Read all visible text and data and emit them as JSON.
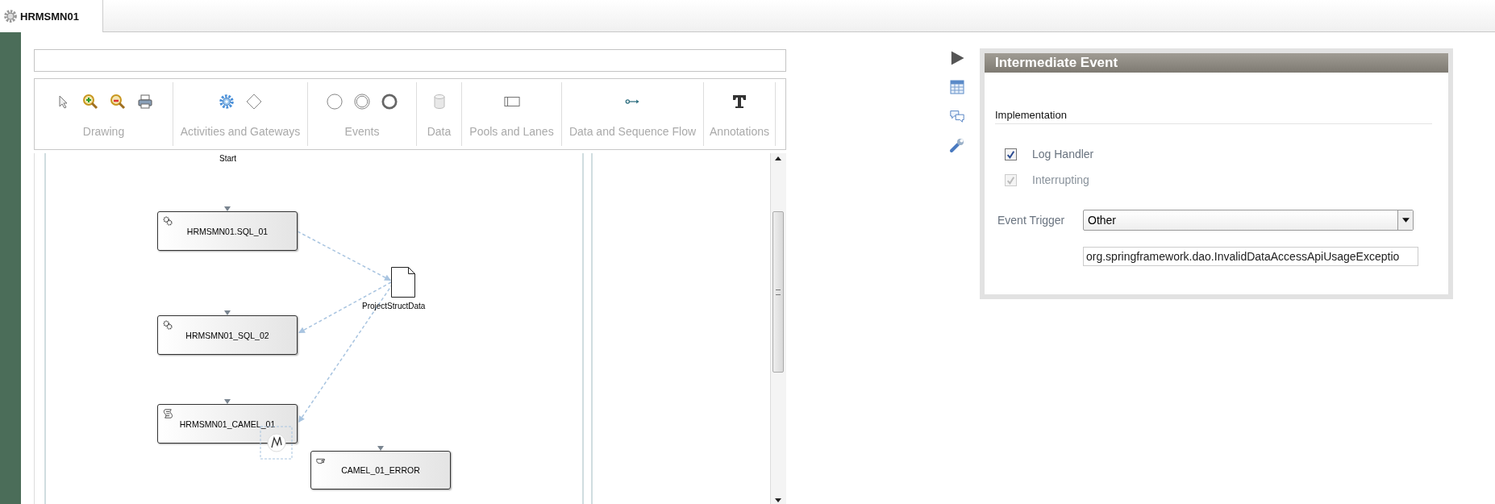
{
  "tab": {
    "label": "HRMSMN01",
    "selected": true
  },
  "toolbar": {
    "groups": [
      {
        "label": "Drawing"
      },
      {
        "label": "Activities and Gateways"
      },
      {
        "label": "Events"
      },
      {
        "label": "Data"
      },
      {
        "label": "Pools and Lanes"
      },
      {
        "label": "Data and Sequence Flow"
      },
      {
        "label": "Annotations"
      }
    ]
  },
  "diagram": {
    "start_label": "Start",
    "tasks": [
      {
        "kind": "service",
        "label": "HRMSMN01.SQL_01"
      },
      {
        "kind": "service",
        "label": "HRMSMN01_SQL_02"
      },
      {
        "kind": "script",
        "label": "HRMSMN01_CAMEL_01"
      },
      {
        "kind": "manual",
        "label": "CAMEL_01_ERROR"
      }
    ],
    "data_object": {
      "label": "ProjectStructData"
    }
  },
  "properties": {
    "title": "Intermediate Event",
    "section": "Implementation",
    "checkboxes": [
      {
        "label": "Log Handler",
        "checked": true,
        "disabled": false
      },
      {
        "label": "Interrupting",
        "checked": true,
        "disabled": true
      }
    ],
    "event_trigger": {
      "label": "Event Trigger",
      "value": "Other"
    },
    "exception_field": {
      "value": "org.springframework.dao.InvalidDataAccessApiUsageExceptio"
    }
  }
}
